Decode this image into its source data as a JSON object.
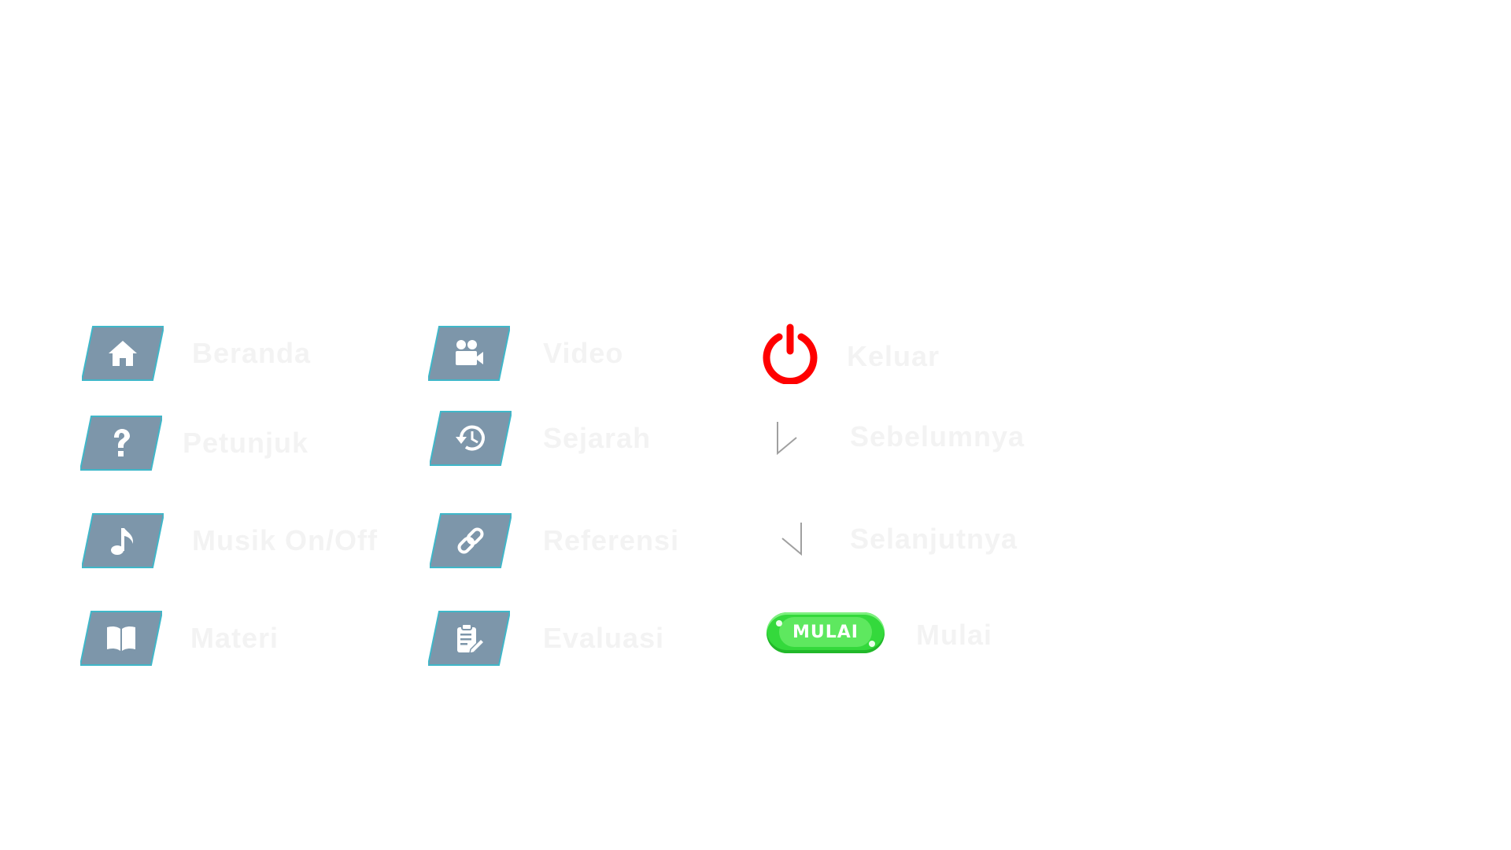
{
  "colors": {
    "tile_fill": "#7d96aa",
    "tile_border": "#3fb7c9",
    "glyph": "#ffffff",
    "power": "#ff0000",
    "mulai_green": "#34d93c",
    "label_text": "#f3f3f3"
  },
  "menu": {
    "col1": [
      {
        "icon": "home-icon",
        "label": "Beranda"
      },
      {
        "icon": "help-icon",
        "label": "Petunjuk"
      },
      {
        "icon": "music-icon",
        "label": "Musik On/Off"
      },
      {
        "icon": "book-icon",
        "label": "Materi"
      }
    ],
    "col2": [
      {
        "icon": "video-camera-icon",
        "label": "Video"
      },
      {
        "icon": "history-icon",
        "label": "Sejarah"
      },
      {
        "icon": "link-icon",
        "label": "Referensi"
      },
      {
        "icon": "clipboard-edit-icon",
        "label": "Evaluasi"
      }
    ],
    "col3": [
      {
        "icon": "power-icon",
        "label": "Keluar"
      },
      {
        "icon": "arrow-left-icon",
        "label": "Sebelumnya"
      },
      {
        "icon": "arrow-right-icon",
        "label": "Selanjutnya"
      },
      {
        "icon": "mulai-button",
        "label": "Mulai"
      }
    ]
  },
  "mulai_button": {
    "text": "MULAI"
  }
}
